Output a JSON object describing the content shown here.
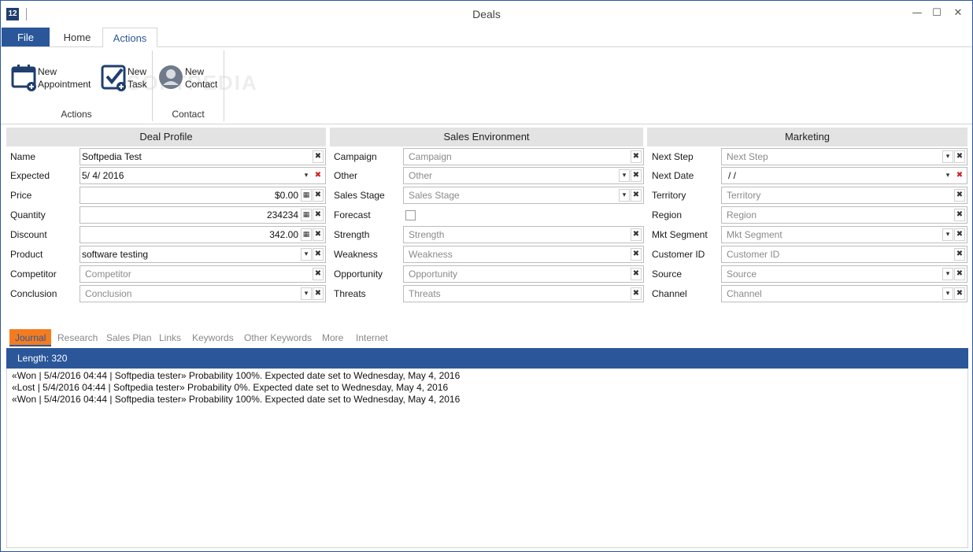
{
  "window": {
    "title": "Deals",
    "logo_text": "12",
    "minimize": "—",
    "maximize": "☐",
    "close": "✕"
  },
  "ribbon_tabs": {
    "file": "File",
    "home": "Home",
    "actions": "Actions"
  },
  "ribbon": {
    "new_appointment": [
      "New",
      "Appointment"
    ],
    "new_task": [
      "New",
      "Task"
    ],
    "new_contact": [
      "New",
      "Contact"
    ],
    "group_actions": "Actions",
    "group_contact": "Contact",
    "watermark": "SOFTPEDIA"
  },
  "deal_profile": {
    "header": "Deal Profile",
    "fields": [
      {
        "label": "Name",
        "value": "Softpedia Test"
      },
      {
        "label": "Expected",
        "value": "5/   4/   2016"
      },
      {
        "label": "Price",
        "value": "$0.00"
      },
      {
        "label": "Quantity",
        "value": "234234"
      },
      {
        "label": "Discount",
        "value": "342.00"
      },
      {
        "label": "Product",
        "value": "software testing"
      },
      {
        "label": "Competitor",
        "placeholder": "Competitor"
      },
      {
        "label": "Conclusion",
        "placeholder": "Conclusion"
      }
    ]
  },
  "sales_environment": {
    "header": "Sales Environment",
    "fields": [
      {
        "label": "Campaign",
        "placeholder": "Campaign"
      },
      {
        "label": "Other",
        "placeholder": "Other"
      },
      {
        "label": "Sales Stage",
        "placeholder": "Sales Stage"
      },
      {
        "label": "Forecast",
        "checked": false
      },
      {
        "label": "Strength",
        "placeholder": "Strength"
      },
      {
        "label": "Weakness",
        "placeholder": "Weakness"
      },
      {
        "label": "Opportunity",
        "placeholder": "Opportunity"
      },
      {
        "label": "Threats",
        "placeholder": "Threats"
      }
    ]
  },
  "marketing": {
    "header": "Marketing",
    "fields": [
      {
        "label": "Next Step",
        "placeholder": "Next Step"
      },
      {
        "label": "Next Date",
        "value": "  /     /"
      },
      {
        "label": "Territory",
        "placeholder": "Territory"
      },
      {
        "label": "Region",
        "placeholder": "Region"
      },
      {
        "label": "Mkt Segment",
        "placeholder": "Mkt Segment"
      },
      {
        "label": "Customer ID",
        "placeholder": "Customer ID"
      },
      {
        "label": "Source",
        "placeholder": "Source"
      },
      {
        "label": "Channel",
        "placeholder": "Channel"
      }
    ]
  },
  "lower_tabs": [
    "Journal",
    "Research",
    "Sales Plan",
    "Links",
    "Keywords",
    "Other Keywords",
    "More",
    "Internet"
  ],
  "journal": {
    "length_label": "Length: 320",
    "entries": [
      "«Won | 5/4/2016 04:44 | Softpedia tester»  Probability 100%.  Expected date set to Wednesday, May 4, 2016",
      "«Lost | 5/4/2016 04:44 | Softpedia tester»  Probability 0%.  Expected date set to Wednesday, May 4, 2016",
      "«Won | 5/4/2016 04:44 | Softpedia tester»  Probability 100%.  Expected date set to Wednesday, May 4, 2016"
    ]
  },
  "glyphs": {
    "clear": "✖",
    "dropdown": "▾",
    "calc": "▦"
  },
  "colors": {
    "accent": "#2b579a",
    "active_tab": "#f47c20",
    "clear_red": "#d02020"
  }
}
